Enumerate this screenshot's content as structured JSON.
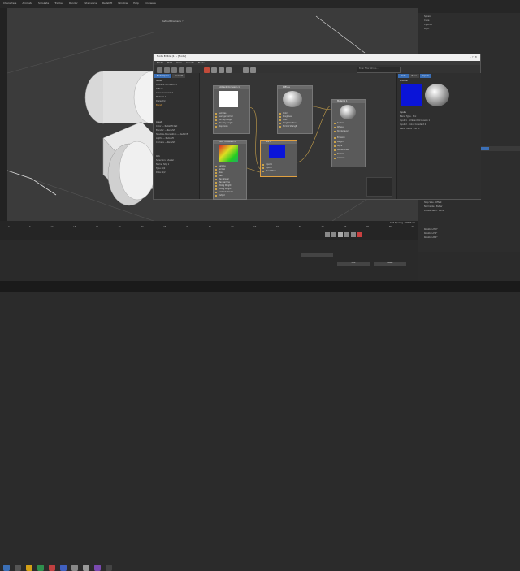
{
  "app": {
    "menu": [
      "Characters",
      "Animate",
      "Simulate",
      "Tracker",
      "Render",
      "Extensions",
      "Redshift",
      "Window",
      "Help",
      "Cineware"
    ],
    "camera_label": "Default Camera ◦°"
  },
  "node_editor": {
    "title": "Node Editor (1) - [Node]",
    "menu": [
      "Mode",
      "Edit",
      "View",
      "Create",
      "Node"
    ],
    "search_placeholder": "Enter Filter Strings...",
    "left_tabs": [
      "Node Space",
      "Redshift"
    ],
    "left_section_label": "Nodes",
    "left_items": [
      "Ambient Occlusion 1",
      "Diffuse",
      "Color Constant 2",
      "Material 1",
      "Dielectric",
      "Blend"
    ],
    "assets_label": "Assets",
    "assets": [
      {
        "name": "Color",
        "type": "Redshift Mat"
      },
      {
        "name": "Blender",
        "type": "Redshift"
      },
      {
        "name": "Shadow Attenuation",
        "type": "Redshift"
      },
      {
        "name": "Lights",
        "type": "Redshift"
      },
      {
        "name": "Camera",
        "type": "Redshift"
      }
    ],
    "info_label": "Info",
    "info": [
      "Selection: Shader 1",
      "Name: Shp 1",
      "Type: 1/2",
      "Date: 1/2"
    ],
    "nodes": {
      "ao": {
        "title": "Ambient Occlusion 1",
        "ports": [
          "Samples",
          "Average Normal",
          "Min Ray Length",
          "Max Ray Length",
          "Dispersion"
        ]
      },
      "diffuse": {
        "title": "Diffuse",
        "ports": [
          "Color",
          "Roughness",
          "Oren",
          "Weight Surface",
          "Normal Strength"
        ]
      },
      "color": {
        "title": "Color Constant 2",
        "ports": [
          "Gamma",
          "Normal",
          "Bias",
          "Gain",
          "Max Shader",
          "Max Gamma",
          "Mixing Weight",
          "Mixing Weight",
          "Gradient Shader",
          "Output"
        ]
      },
      "material": {
        "title": "Material 1",
        "ports": [
          "Surface",
          "Diffuse",
          "Shade Layer",
          "Emission",
          "Weight",
          "Alpha",
          "Displacement",
          "Normal",
          "Ambient"
        ]
      },
      "mix": {
        "title": "Mix 1",
        "ports": [
          "Input 1",
          "Input 2",
          "Blend Mode"
        ]
      }
    }
  },
  "right_attr": {
    "tabs": [
      "Node",
      "Basic",
      "Inputs"
    ],
    "preview_label": "Preview",
    "inputs_label": "Inputs",
    "fields": [
      {
        "label": "Blend Type",
        "value": "Mix"
      },
      {
        "label": "Input 1",
        "value": "Ambient Occlusion 1"
      },
      {
        "label": "Input 2",
        "value": "Color Constant 2"
      },
      {
        "label": "Blend Factor",
        "value": "50 %"
      }
    ]
  },
  "object_manager": {
    "items": [
      "Sphere",
      "Cube",
      "Cylinder",
      "Light"
    ]
  },
  "attributes_panel": {
    "rows": [
      {
        "label": "Enable",
        "value": "Offset"
      },
      {
        "label": "Stop Size",
        "value": "Offset"
      },
      {
        "label": "Normalize",
        "value": "Buffer"
      },
      {
        "label": "Enable Seed",
        "value": "Buffer"
      }
    ],
    "buttons": [
      "Edit",
      "Reset"
    ],
    "coord_labels": [
      "Rotation.H",
      "Rotation.P",
      "Rotation.B"
    ],
    "coord_values": [
      "0°",
      "0°",
      "0°"
    ]
  },
  "timeline": {
    "grid_spacing": "Grid Spacing : 10000 cm",
    "frames": [
      "0",
      "5",
      "10",
      "15",
      "20",
      "25",
      "30",
      "35",
      "40",
      "45",
      "50",
      "55",
      "60",
      "65",
      "70",
      "75",
      "80",
      "85",
      "90"
    ]
  },
  "colors": {
    "accent": "#3b6fb6",
    "diffuse_preview": "#ffffff",
    "mix_preview": "#0a14d8"
  }
}
